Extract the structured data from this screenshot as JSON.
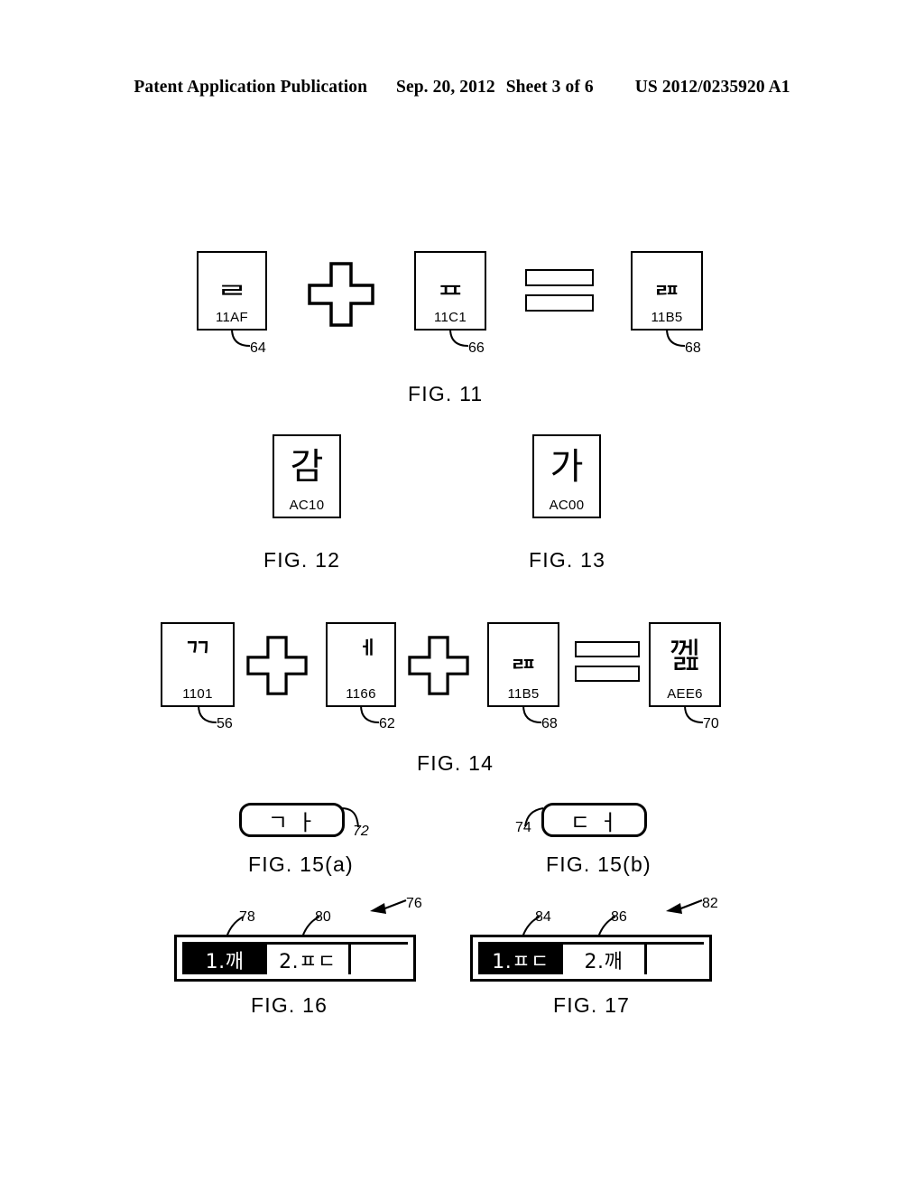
{
  "header": {
    "title": "Patent Application Publication",
    "date": "Sep. 20, 2012",
    "sheet": "Sheet 3 of 6",
    "number": "US 2012/0235920 A1"
  },
  "figures": {
    "fig11": {
      "caption": "FIG. 11",
      "items": [
        {
          "glyph": "ᆯ",
          "code": "11AF",
          "ref": "64"
        },
        {
          "operator": "plus"
        },
        {
          "glyph": "ᇁ",
          "code": "11C1",
          "ref": "66"
        },
        {
          "operator": "equals"
        },
        {
          "glyph": "ᆵ",
          "code": "11B5",
          "ref": "68"
        }
      ]
    },
    "fig12": {
      "caption": "FIG. 12",
      "glyph": "감",
      "code": "AC10"
    },
    "fig13": {
      "caption": "FIG. 13",
      "glyph": "가",
      "code": "AC00"
    },
    "fig14": {
      "caption": "FIG. 14",
      "items": [
        {
          "glyph": "ᄁ",
          "code": "1101",
          "ref": "56"
        },
        {
          "operator": "plus"
        },
        {
          "glyph": "ᅦ",
          "code": "1166",
          "ref": "62"
        },
        {
          "operator": "plus"
        },
        {
          "glyph": "ᆵ",
          "code": "11B5",
          "ref": "68"
        },
        {
          "operator": "equals"
        },
        {
          "glyph": "껦",
          "code": "AEE6",
          "ref": "70"
        }
      ]
    },
    "fig15a": {
      "caption": "FIG. 15(a)",
      "keys": "ㄱㅏ",
      "ref": "72"
    },
    "fig15b": {
      "caption": "FIG. 15(b)",
      "keys": "ㄷㅓ",
      "ref": "74"
    },
    "fig16": {
      "caption": "FIG. 16",
      "ref": "76",
      "cells": [
        {
          "label": "1.깨",
          "ref": "78",
          "selected": true
        },
        {
          "label": "2.ㅍㄷ",
          "ref": "80",
          "selected": false
        },
        {
          "label": "",
          "selected": false
        }
      ]
    },
    "fig17": {
      "caption": "FIG. 17",
      "ref": "82",
      "cells": [
        {
          "label": "1.ㅍㄷ",
          "ref": "84",
          "selected": true
        },
        {
          "label": "2.깨",
          "ref": "86",
          "selected": false
        },
        {
          "label": "",
          "selected": false
        }
      ]
    }
  }
}
